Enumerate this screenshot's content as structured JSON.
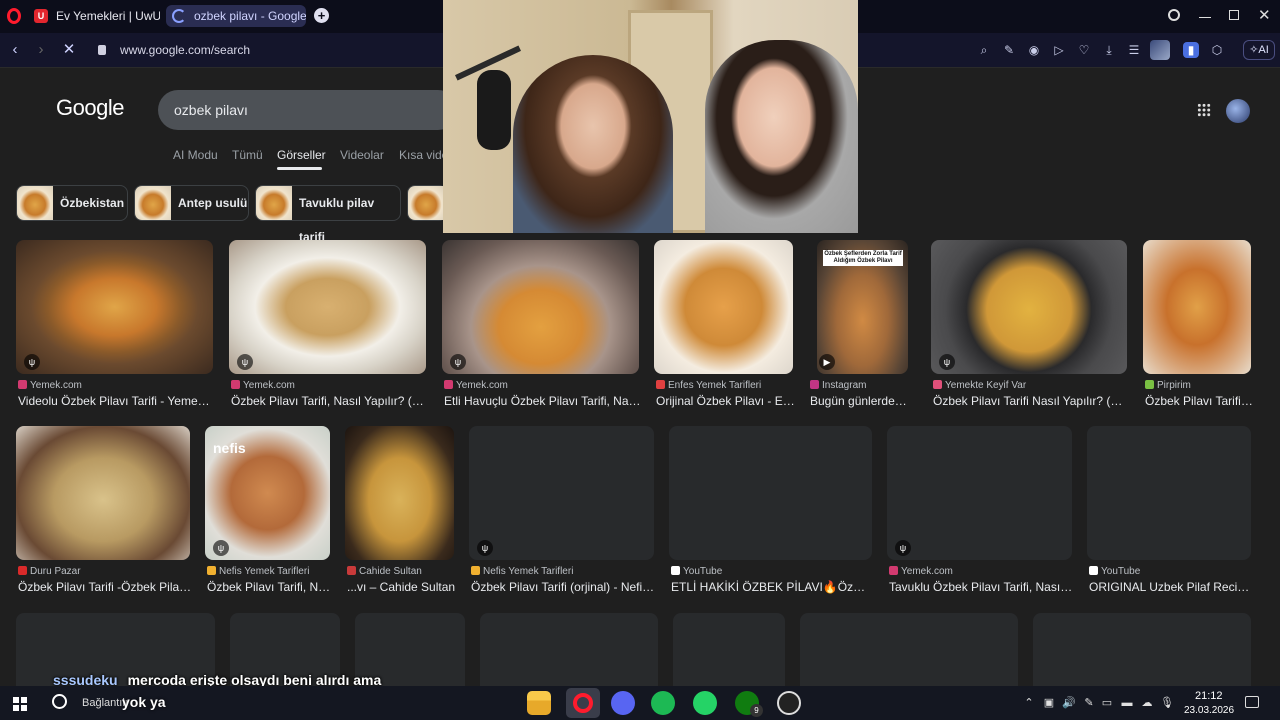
{
  "browser": {
    "tabs": [
      {
        "label": "Ev Yemekleri | UwUFUFU"
      },
      {
        "label": "ozbek pilavı - Google'da A"
      }
    ],
    "new_tab": "+",
    "url": "www.google.com/search",
    "ai_label": "AI"
  },
  "google": {
    "logo": "Google",
    "query": "ozbek pilavı",
    "tabs": [
      "AI Modu",
      "Tümü",
      "Görseller",
      "Videolar",
      "Kısa vide"
    ],
    "active_tab": "Görseller",
    "chips": [
      "Özbekistan",
      "Antep usulü",
      "Tavuklu pilav tarifi"
    ]
  },
  "results_row1": [
    {
      "source": "Yemek.com",
      "title": "Videolu Özbek Pilavı Tarifi - Yemek.com",
      "src_color": "#d23a70"
    },
    {
      "source": "Yemek.com",
      "title": "Özbek Pilavı Tarifi, Nasıl Yapılır? (Re...",
      "src_color": "#d23a70"
    },
    {
      "source": "Yemek.com",
      "title": "Etli Havuçlu Özbek Pilavı Tarifi, Nasıl ...",
      "src_color": "#d23a70"
    },
    {
      "source": "Enfes Yemek Tarifleri",
      "title": "Orijinal Özbek Pilavı - En...",
      "src_color": "#e04040"
    },
    {
      "source": "Instagram",
      "title": "Bugün günlerden ...",
      "src_color": "#c13584"
    },
    {
      "source": "Yemekte Keyif Var",
      "title": "Özbek Pilavı Tarifi Nasıl Yapılır? (Vid...",
      "src_color": "#e0507a"
    },
    {
      "source": "Pirpirim",
      "title": "Özbek Pilavı Tarifi ...",
      "src_color": "#7ac043"
    }
  ],
  "results_row2": [
    {
      "source": "Duru Pazar",
      "title": "Özbek Pilavı Tarifi -Özbek Pilavı ...",
      "src_color": "#d92a2a"
    },
    {
      "source": "Nefis Yemek Tarifleri",
      "title": "Özbek Pilavı Tarifi, Na...",
      "src_color": "#f0b030"
    },
    {
      "source": "Cahide Sultan",
      "title": "...vı – Cahide Sultan",
      "src_color": "#c83a3a"
    },
    {
      "source": "Nefis Yemek Tarifleri",
      "title": "Özbek Pilavı Tarifi (orjinal) - Nefis ...",
      "src_color": "#f0b030"
    },
    {
      "source": "YouTube",
      "title": "ETLİ HAKİKİ ÖZBEK PİLAVI🔥Özbek ...",
      "src_color": "#ffffff"
    },
    {
      "source": "Yemek.com",
      "title": "Tavuklu Özbek Pilavı Tarifi, Nasıl Y...",
      "src_color": "#d23a70"
    },
    {
      "source": "YouTube",
      "title": "ORIGINAL Uzbek Pilaf Recipe...",
      "src_color": "#ffffff"
    }
  ],
  "image_overlay_text": "Özbek Şeflerden Zorla Tarif Aldığım Özbek Pilavı",
  "nefis_logo": "nefis",
  "chat": {
    "user": "sssudeku",
    "message": "mercoda erişte olsaydı beni alırdı ama",
    "message2": "yok ya"
  },
  "taskbar": {
    "search_hint": "Bağlantılı",
    "time": "21:12",
    "date": "23.03.2026",
    "badge_count": "9"
  },
  "colors": {
    "accent": "#8ab4f8",
    "browser_bg": "#0c0d1a",
    "page_bg": "#1f1f1f"
  }
}
